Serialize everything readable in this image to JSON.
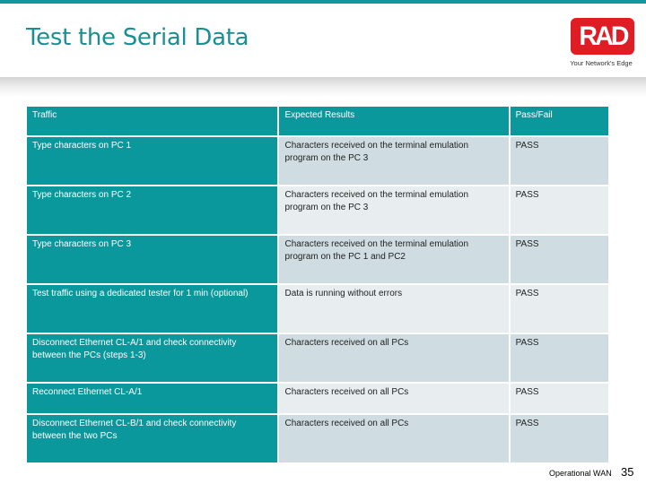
{
  "slide": {
    "title": "Test the Serial Data",
    "logo": {
      "text": "RAD",
      "tagline": "Your Network's Edge",
      "color": "#e01d24"
    },
    "accent_color": "#0a989c"
  },
  "table": {
    "headers": [
      "Traffic",
      "Expected Results",
      "Pass/Fail"
    ],
    "rows": [
      {
        "traffic": "Type characters on PC 1",
        "expected": "Characters received on the terminal emulation program on the PC 3",
        "result": "PASS"
      },
      {
        "traffic": "Type characters on PC 2",
        "expected": "Characters received on the terminal emulation program on the PC 3",
        "result": "PASS"
      },
      {
        "traffic": "Type characters on PC 3",
        "expected": "Characters received on the terminal emulation program on the PC 1 and PC2",
        "result": "PASS"
      },
      {
        "traffic": "Test traffic using a dedicated tester for 1 min (optional)",
        "expected": "Data is running without errors",
        "result": "PASS"
      },
      {
        "traffic": "Disconnect Ethernet CL-A/1 and check connectivity between the PCs (steps 1-3)",
        "expected": "Characters received on all PCs",
        "result": "PASS"
      },
      {
        "traffic": "Reconnect Ethernet CL-A/1",
        "expected": "Characters received on all PCs",
        "result": "PASS"
      },
      {
        "traffic": "Disconnect Ethernet CL-B/1 and check connectivity between the two PCs",
        "expected": "Characters received on all PCs",
        "result": "PASS"
      }
    ]
  },
  "footer": {
    "label": "Operational WAN",
    "page_number": "35"
  }
}
